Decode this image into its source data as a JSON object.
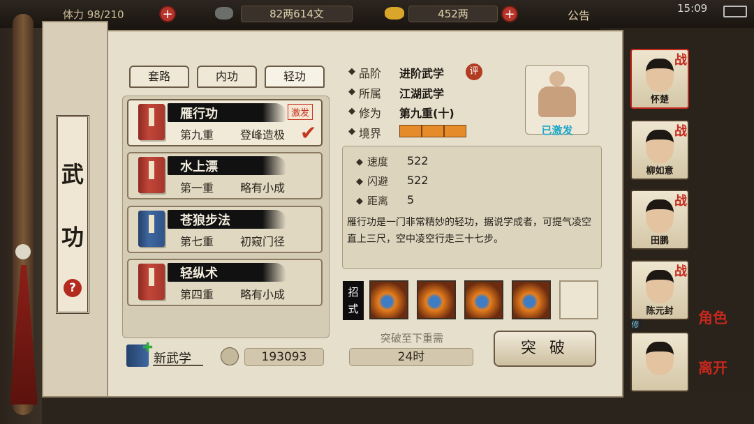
{
  "top_bar": {
    "stamina": "体力 98/210",
    "silver": "82两614文",
    "gold": "452两",
    "notice_label": "公告",
    "time": "15:09"
  },
  "scroll": {
    "title_chars": [
      "武",
      "功"
    ],
    "help_glyph": "?"
  },
  "tabs": [
    {
      "label": "套路",
      "active": false
    },
    {
      "label": "内功",
      "active": false
    },
    {
      "label": "轻功",
      "active": true
    }
  ],
  "skills": [
    {
      "name": "雁行功",
      "level": "第九重",
      "rank": "登峰造极",
      "book": "red",
      "badge": "激发",
      "selected": true
    },
    {
      "name": "水上漂",
      "level": "第一重",
      "rank": "略有小成",
      "book": "red"
    },
    {
      "name": "苍狼步法",
      "level": "第七重",
      "rank": "初窥门径",
      "book": "blue"
    },
    {
      "name": "轻纵术",
      "level": "第四重",
      "rank": "略有小成",
      "book": "red"
    }
  ],
  "footer": {
    "new_skill_label": "新武学",
    "points_value": "193093"
  },
  "info": {
    "grade": {
      "label": "品阶",
      "value": "进阶武学",
      "rate_glyph": "评"
    },
    "belong": {
      "label": "所属",
      "value": "江湖武学"
    },
    "cultivation": {
      "label": "修为",
      "value": "第九重(十)"
    },
    "realm": {
      "label": "境界",
      "segments": 3
    },
    "activated_label": "已激发"
  },
  "stats": [
    {
      "label": "速度",
      "value": "522"
    },
    {
      "label": "闪避",
      "value": "522"
    },
    {
      "label": "距离",
      "value": "5"
    }
  ],
  "description": "雁行功是一门非常精妙的轻功，据说学成者，可提气凌空直上三尺，空中凌空行走三十七步。",
  "moves": {
    "label_chars": [
      "招",
      "式"
    ],
    "slots": [
      {
        "icon": "move-1-icon",
        "filled": true
      },
      {
        "icon": "move-2-icon",
        "filled": true
      },
      {
        "icon": "move-3-icon",
        "filled": true
      },
      {
        "icon": "move-4-icon",
        "filled": true
      },
      {
        "icon": "empty-slot",
        "filled": false
      }
    ]
  },
  "breakthrough": {
    "requirement_label": "突破至下重需",
    "requirement_value": "24时",
    "button_label": "突 破"
  },
  "characters": [
    {
      "name": "怀楚",
      "badge": "战",
      "selected": true
    },
    {
      "name": "柳如意",
      "badge": "战"
    },
    {
      "name": "田鹏",
      "badge": "战"
    },
    {
      "name": "陈元封",
      "badge": "战",
      "cultivate_badge": "修"
    },
    {
      "name": "",
      "badge": ""
    }
  ],
  "side_actions": [
    {
      "label": "角色"
    },
    {
      "label": "离开"
    }
  ],
  "colors": {
    "accent_red": "#c4291d",
    "activated_cyan": "#1fa6c9",
    "realm_orange": "#e58b2a"
  }
}
